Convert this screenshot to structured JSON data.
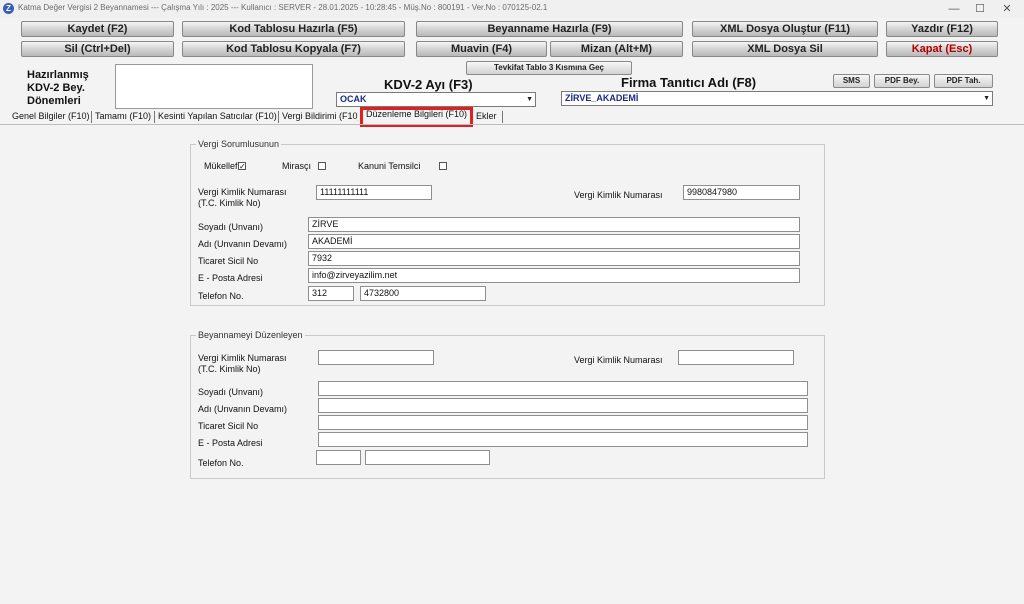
{
  "window": {
    "title": "Katma Değer Vergisi 2 Beyannamesi  ---  Çalışma Yılı : 2025  ---  Kullanıcı : SERVER - 28.01.2025 - 10:28:45 - Müş.No : 800191 - Ver.No : 070125-02.1",
    "app_icon": "Z",
    "minimize": "—",
    "maximize": "☐",
    "close": "✕"
  },
  "toolbar": {
    "row1": [
      "Kaydet (F2)",
      "Kod Tablosu Hazırla (F5)",
      "Beyanname Hazırla (F9)",
      "XML Dosya Oluştur (F11)",
      "Yazdır (F12)"
    ],
    "row2": [
      "Sil (Ctrl+Del)",
      "Kod Tablosu Kopyala (F7)",
      "Muavin (F4)",
      "Mizan (Alt+M)",
      "XML Dosya Sil",
      "Kapat (Esc)"
    ],
    "tevkifat": "Tevkifat Tablo 3 Kısmına Geç",
    "sms": "SMS",
    "pdf_bey": "PDF Bey.",
    "pdf_tah": "PDF Tah."
  },
  "header": {
    "hazirlanmis": "Hazırlanmış",
    "kdv2bey": "KDV-2 Bey.",
    "donemleri": "Dönemleri",
    "kdv2_ayi_label": "KDV-2 Ayı (F3)",
    "kdv2_ayi_value": "OCAK",
    "firma_label": "Firma Tanıtıcı Adı (F8)",
    "firma_value": "ZİRVE_AKADEMİ"
  },
  "tabs": [
    "Genel Bilgiler (F10)",
    "Tamamı (F10)",
    "Kesinti Yapılan Satıcılar (F10)",
    "Vergi Bildirimi (F10)",
    "Düzenleme Bilgileri (F10)",
    "Ekler"
  ],
  "vergi_sorumlusu": {
    "title": "Vergi Sorumlusunun",
    "mukellef": "Mükellef",
    "mukellef_checked": "✓",
    "mirasci": "Mirasçı",
    "kanuni": "Kanuni Temsilci",
    "tckn_label1": "Vergi Kimlik Numarası",
    "tckn_label2": "(T.C. Kimlik No)",
    "tckn_value": "11111111111",
    "vkn_label": "Vergi Kimlik Numarası",
    "vkn_value": "9980847980",
    "soyadi_label": "Soyadı (Unvanı)",
    "soyadi_value": "ZİRVE",
    "adi_label": "Adı (Unvanın Devamı)",
    "adi_value": "AKADEMİ",
    "ticaret_label": "Ticaret Sicil No",
    "ticaret_value": "7932",
    "eposta_label": "E - Posta Adresi",
    "eposta_value": "info@zirveyazilim.net",
    "telefon_label": "Telefon No.",
    "telefon_kod": "312",
    "telefon_no": "4732800"
  },
  "duzenleyen": {
    "title": "Beyannameyi Düzenleyen",
    "tckn_label1": "Vergi Kimlik Numarası",
    "tckn_label2": "(T.C. Kimlik No)",
    "vkn_label": "Vergi Kimlik Numarası",
    "soyadi_label": "Soyadı (Unvanı)",
    "adi_label": "Adı (Unvanın Devamı)",
    "ticaret_label": "Ticaret Sicil No",
    "eposta_label": "E - Posta Adresi",
    "telefon_label": "Telefon No."
  },
  "colors": {
    "highlight": "#e02020",
    "combo_text": "#1a2a8a",
    "danger_text": "#b40000"
  }
}
